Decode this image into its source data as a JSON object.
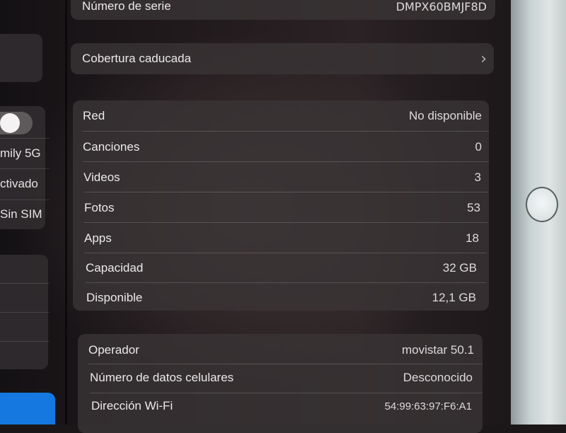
{
  "header": {
    "serial_label": "Número de serie",
    "serial_value": "DMPX60BMJF8D"
  },
  "coverage": {
    "label": "Cobertura caducada"
  },
  "device_info": [
    {
      "label": "Red",
      "value": "No disponible"
    },
    {
      "label": "Canciones",
      "value": "0"
    },
    {
      "label": "Videos",
      "value": "3"
    },
    {
      "label": "Fotos",
      "value": "53"
    },
    {
      "label": "Apps",
      "value": "18"
    },
    {
      "label": "Capacidad",
      "value": "32 GB"
    },
    {
      "label": "Disponible",
      "value": "12,1 GB"
    }
  ],
  "network_info": [
    {
      "label": "Operador",
      "value": "movistar 50.1"
    },
    {
      "label": "Número de datos celulares",
      "value": "Desconocido"
    },
    {
      "label": "Dirección Wi-Fi",
      "value": "54:99:63:97:F6:A1"
    }
  ],
  "sidebar": {
    "items": [
      {
        "label": "mily 5G"
      },
      {
        "label": "ctivado"
      },
      {
        "label": "Sin SIM"
      }
    ]
  }
}
